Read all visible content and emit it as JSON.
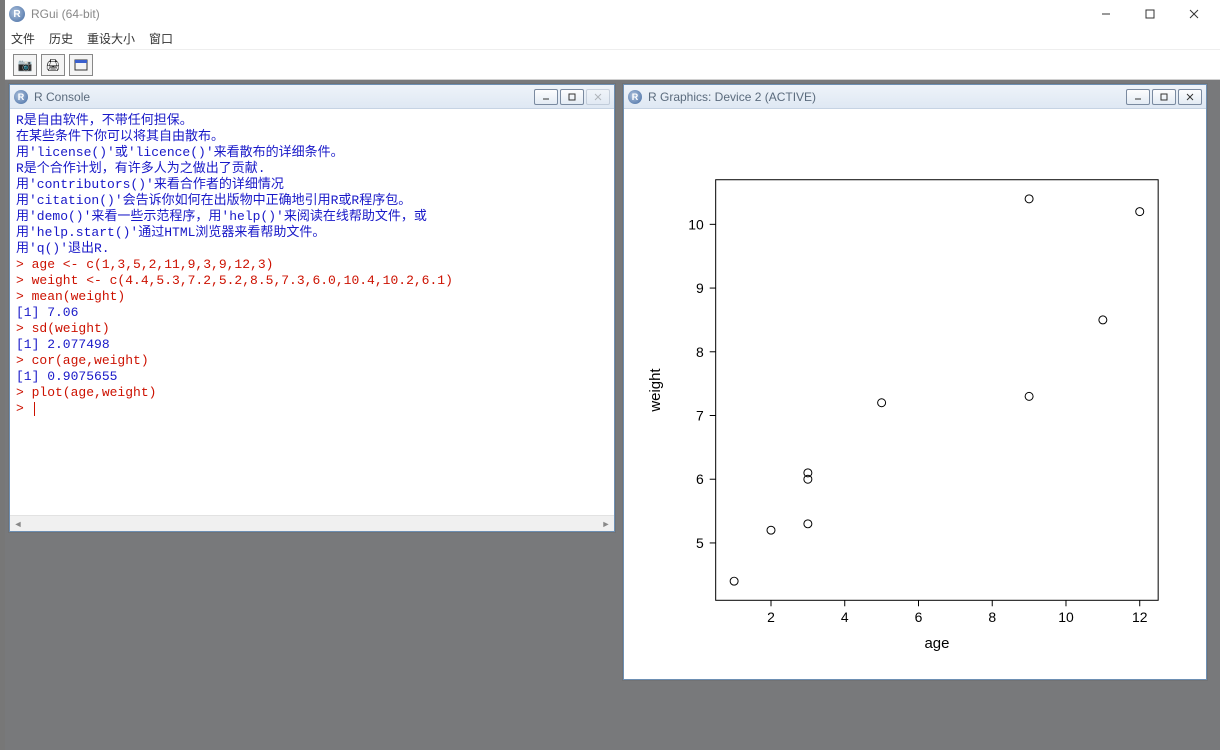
{
  "main_window": {
    "title": "RGui (64-bit)",
    "menu": [
      "文件",
      "历史",
      "重设大小",
      "窗口"
    ],
    "toolbar": [
      "camera",
      "printer",
      "cascade"
    ]
  },
  "console_window": {
    "title": "R Console",
    "lines": [
      {
        "cls": "blue",
        "text": ""
      },
      {
        "cls": "blue",
        "text": "R是自由软件，不带任何担保。"
      },
      {
        "cls": "blue",
        "text": "在某些条件下你可以将其自由散布。"
      },
      {
        "cls": "blue",
        "text": "用'license()'或'licence()'来看散布的详细条件。"
      },
      {
        "cls": "blue",
        "text": ""
      },
      {
        "cls": "blue",
        "text": "R是个合作计划，有许多人为之做出了贡献."
      },
      {
        "cls": "blue",
        "text": "用'contributors()'来看合作者的详细情况"
      },
      {
        "cls": "blue",
        "text": "用'citation()'会告诉你如何在出版物中正确地引用R或R程序包。"
      },
      {
        "cls": "blue",
        "text": ""
      },
      {
        "cls": "blue",
        "text": "用'demo()'来看一些示范程序，用'help()'来阅读在线帮助文件，或"
      },
      {
        "cls": "blue",
        "text": "用'help.start()'通过HTML浏览器来看帮助文件。"
      },
      {
        "cls": "blue",
        "text": "用'q()'退出R."
      },
      {
        "cls": "blue",
        "text": ""
      },
      {
        "cls": "red",
        "text": "> age <- c(1,3,5,2,11,9,3,9,12,3)"
      },
      {
        "cls": "red",
        "text": "> weight <- c(4.4,5.3,7.2,5.2,8.5,7.3,6.0,10.4,10.2,6.1)"
      },
      {
        "cls": "red",
        "text": "> mean(weight)"
      },
      {
        "cls": "blue",
        "text": "[1] 7.06"
      },
      {
        "cls": "red",
        "text": "> sd(weight)"
      },
      {
        "cls": "blue",
        "text": "[1] 2.077498"
      },
      {
        "cls": "red",
        "text": "> cor(age,weight)"
      },
      {
        "cls": "blue",
        "text": "[1] 0.9075655"
      },
      {
        "cls": "red",
        "text": "> plot(age,weight)"
      }
    ],
    "prompt": "> "
  },
  "graphics_window": {
    "title": "R Graphics: Device 2 (ACTIVE)"
  },
  "chart_data": {
    "type": "scatter",
    "xlabel": "age",
    "ylabel": "weight",
    "x_ticks": [
      2,
      4,
      6,
      8,
      10,
      12
    ],
    "y_ticks": [
      5,
      6,
      7,
      8,
      9,
      10
    ],
    "xlim": [
      1,
      12
    ],
    "ylim": [
      4.4,
      10.4
    ],
    "points": [
      {
        "x": 1,
        "y": 4.4
      },
      {
        "x": 3,
        "y": 5.3
      },
      {
        "x": 5,
        "y": 7.2
      },
      {
        "x": 2,
        "y": 5.2
      },
      {
        "x": 11,
        "y": 8.5
      },
      {
        "x": 9,
        "y": 7.3
      },
      {
        "x": 3,
        "y": 6.0
      },
      {
        "x": 9,
        "y": 10.4
      },
      {
        "x": 12,
        "y": 10.2
      },
      {
        "x": 3,
        "y": 6.1
      }
    ]
  }
}
